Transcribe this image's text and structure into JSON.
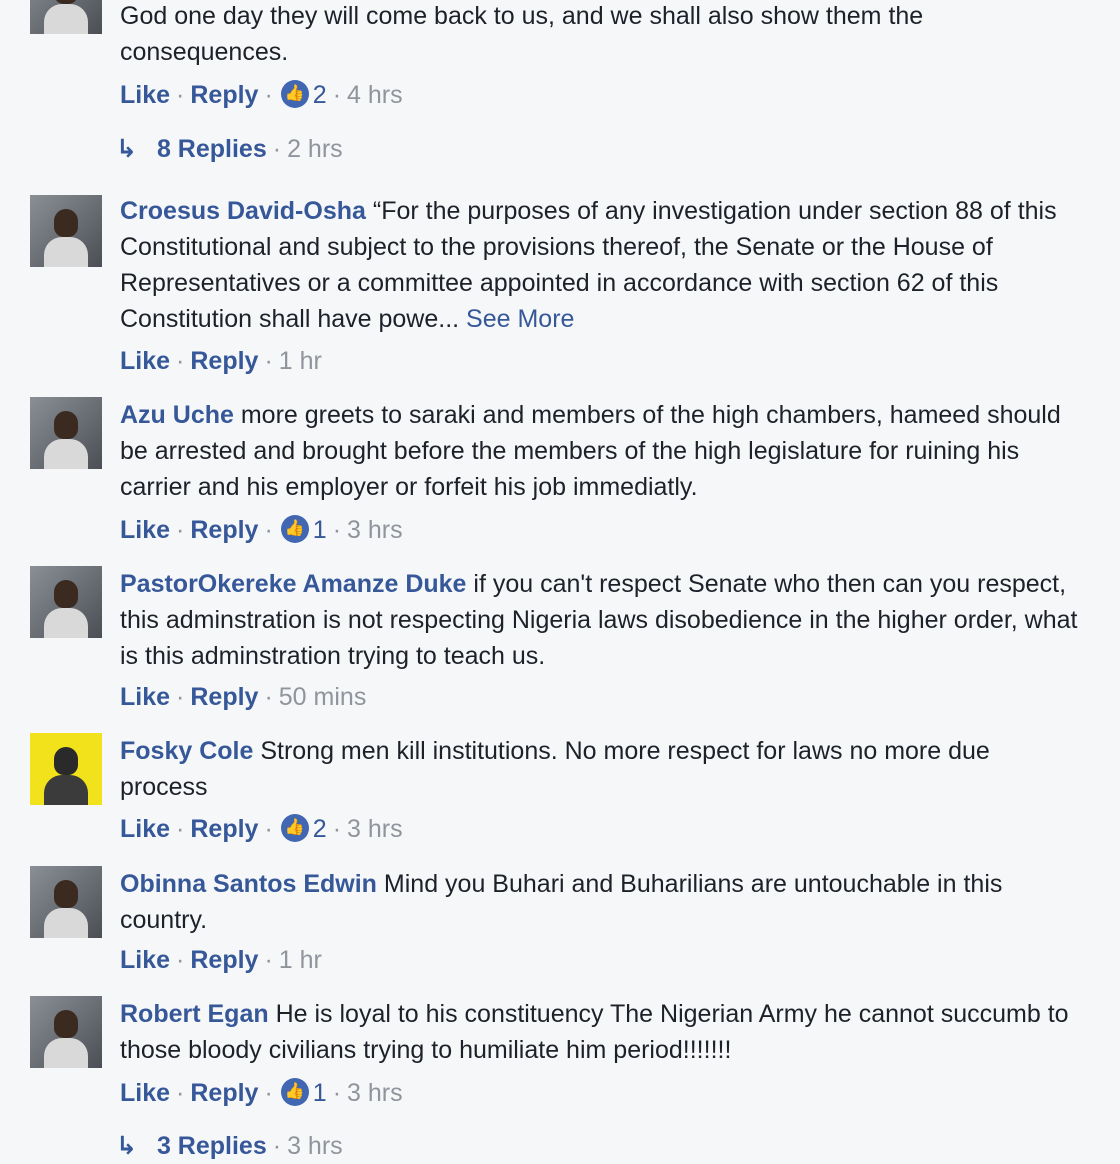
{
  "comments": [
    {
      "author": "",
      "text": "God one day they will come back to us, and we shall also show them the consequences.",
      "like": "Like",
      "reply": "Reply",
      "likes": "2",
      "time": "4 hrs",
      "replies_label": "8 Replies",
      "replies_time": "2 hrs"
    },
    {
      "author": "Croesus David-Osha",
      "text": "“For the purposes of any investigation under section 88 of this Constitutional and subject to the provisions thereof, the Senate or the House of Representatives or a committee appointed in accordance with section 62 of this Constitution shall have powe...",
      "see_more": "See More",
      "like": "Like",
      "reply": "Reply",
      "time": "1 hr"
    },
    {
      "author": "Azu Uche",
      "text": "more greets to saraki and members of the high chambers, hameed should be arrested and brought before the members of the high legislature for ruining his carrier and his employer or forfeit his job immediatly.",
      "like": "Like",
      "reply": "Reply",
      "likes": "1",
      "time": "3 hrs"
    },
    {
      "author": "PastorOkereke Amanze Duke",
      "text": "if you can't respect Senate who then can you respect, this adminstration is not respecting Nigeria laws disobedience in the higher order, what is this adminstration trying to teach us.",
      "like": "Like",
      "reply": "Reply",
      "time": "50 mins"
    },
    {
      "author": "Fosky Cole",
      "text": "Strong men kill institutions. No more respect for laws no more due process",
      "like": "Like",
      "reply": "Reply",
      "likes": "2",
      "time": "3 hrs"
    },
    {
      "author": "Obinna Santos Edwin",
      "text": "Mind you Buhari and Buharilians are untouchable in this country.",
      "like": "Like",
      "reply": "Reply",
      "time": "1 hr"
    },
    {
      "author": "Robert Egan",
      "text": "He is loyal to his constituency The Nigerian Army he cannot succumb to those bloody civilians trying to humiliate him period!!!!!!!",
      "like": "Like",
      "reply": "Reply",
      "likes": "1",
      "time": "3 hrs",
      "replies_label": "3 Replies",
      "replies_time": "3 hrs"
    }
  ],
  "icons": {
    "like_badge": "thumbs-up-icon",
    "reply_arrow": "reply-arrow-icon"
  },
  "colors": {
    "link": "#365899",
    "meta": "#90949c",
    "like_badge": "#4267b2"
  }
}
